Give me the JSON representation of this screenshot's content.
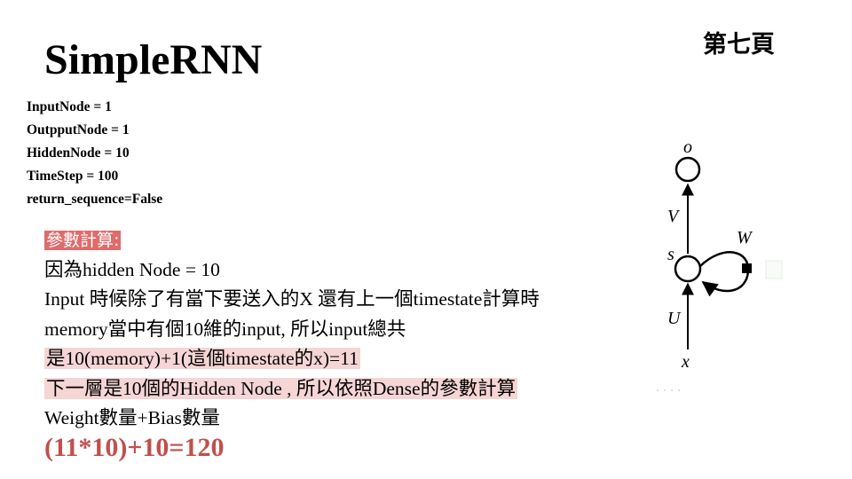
{
  "page_number": "第七頁",
  "title": "SimpleRNN",
  "params": [
    "InputNode = 1",
    "OutpputNode = 1",
    "HiddenNode = 10",
    "TimeStep = 100",
    "return_sequence=False"
  ],
  "explanation": {
    "heading": "參數計算:",
    "line1": "因為hidden Node = 10",
    "line2": "Input 時候除了有當下要送入的X 還有上一個timestate計算時",
    "line3": "memory當中有個10維的input, 所以input總共",
    "line4": "是10(memory)+1(這個timestate的x)=11",
    "line5": "下一層是10個的Hidden Node , 所以依照Dense的參數計算",
    "line6": "Weight數量+Bias數量"
  },
  "result": "(11*10)+10=120",
  "diagram": {
    "label_o": "o",
    "label_v": "V",
    "label_s": "s",
    "label_w": "W",
    "label_u": "U",
    "label_x": "x"
  },
  "colors": {
    "highlight_strong": "#e06b6b",
    "highlight_soft": "#f6d5d5",
    "result": "#c0504d"
  }
}
